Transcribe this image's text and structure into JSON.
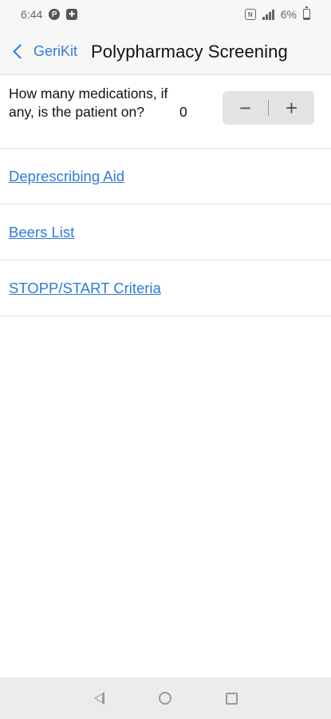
{
  "status_bar": {
    "time": "6:44",
    "battery_percent": "6%",
    "left_icons": [
      "p-circle-icon",
      "notification-app-icon"
    ],
    "right_icons": [
      "nfc-icon",
      "signal-icon",
      "battery-icon"
    ]
  },
  "nav": {
    "back_label": "GeriKit",
    "title": "Polypharmacy Screening"
  },
  "medications": {
    "question": "How many medications, if any, is the patient on?",
    "count": "0",
    "decrement_label": "−",
    "increment_label": "+"
  },
  "links": [
    {
      "label": "Deprescribing Aid"
    },
    {
      "label": "Beers List"
    },
    {
      "label": "STOPP/START Criteria"
    }
  ],
  "colors": {
    "accent": "#2f7bd8",
    "bar_background": "#f7f7f7",
    "divider": "#dcdcdc",
    "stepper_background": "#e3e3e3"
  }
}
